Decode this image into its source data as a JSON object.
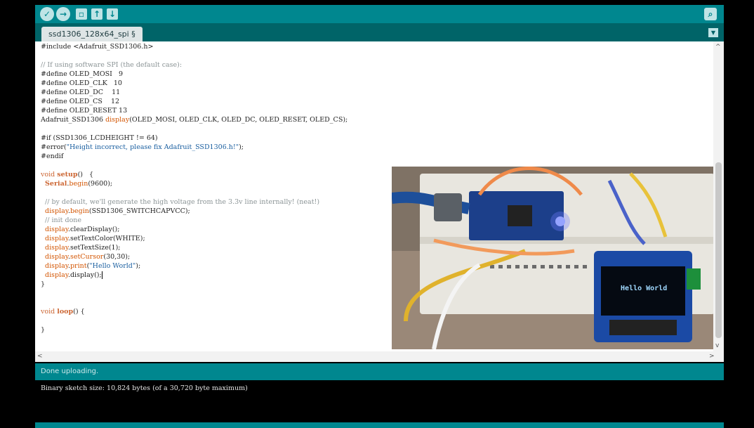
{
  "tab": {
    "label": "ssd1306_128x64_spi §"
  },
  "code": [
    [
      {
        "t": "#include <Adafruit_SSD1306.h>",
        "c": ""
      }
    ],
    [
      {
        "t": "",
        "c": ""
      }
    ],
    [
      {
        "t": "// If using software SPI (the default case):",
        "c": "cmt"
      }
    ],
    [
      {
        "t": "#define OLED_MOSI   9",
        "c": ""
      }
    ],
    [
      {
        "t": "#define OLED_CLK   10",
        "c": ""
      }
    ],
    [
      {
        "t": "#define OLED_DC    11",
        "c": ""
      }
    ],
    [
      {
        "t": "#define OLED_CS    12",
        "c": ""
      }
    ],
    [
      {
        "t": "#define OLED_RESET 13",
        "c": ""
      }
    ],
    [
      {
        "t": "Adafruit_SSD1306 ",
        "c": ""
      },
      {
        "t": "display",
        "c": "fn"
      },
      {
        "t": "(OLED_MOSI, OLED_CLK, OLED_DC, OLED_RESET, OLED_CS);",
        "c": ""
      }
    ],
    [
      {
        "t": "",
        "c": ""
      }
    ],
    [
      {
        "t": "#if (SSD1306_LCDHEIGHT != 64)",
        "c": ""
      }
    ],
    [
      {
        "t": "#error(",
        "c": ""
      },
      {
        "t": "\"Height incorrect, please fix Adafruit_SSD1306.h!\"",
        "c": "str"
      },
      {
        "t": ");",
        "c": ""
      }
    ],
    [
      {
        "t": "#endif",
        "c": ""
      }
    ],
    [
      {
        "t": "",
        "c": ""
      }
    ],
    [
      {
        "t": "void ",
        "c": "kw"
      },
      {
        "t": "setup",
        "c": "kwb"
      },
      {
        "t": "()   {",
        "c": ""
      }
    ],
    [
      {
        "t": "  ",
        "c": ""
      },
      {
        "t": "Serial",
        "c": "kwb"
      },
      {
        "t": ".",
        "c": ""
      },
      {
        "t": "begin",
        "c": "fn"
      },
      {
        "t": "(9600);",
        "c": ""
      }
    ],
    [
      {
        "t": "",
        "c": ""
      }
    ],
    [
      {
        "t": "  // by default, we'll generate the high voltage from the 3.3v line internally! (neat!)",
        "c": "cmt"
      }
    ],
    [
      {
        "t": "  ",
        "c": ""
      },
      {
        "t": "display",
        "c": "fn"
      },
      {
        "t": ".",
        "c": ""
      },
      {
        "t": "begin",
        "c": "fn"
      },
      {
        "t": "(SSD1306_SWITCHCAPVCC);",
        "c": ""
      }
    ],
    [
      {
        "t": "  // init done",
        "c": "cmt"
      }
    ],
    [
      {
        "t": "  ",
        "c": ""
      },
      {
        "t": "display",
        "c": "fn"
      },
      {
        "t": ".clearDisplay();",
        "c": ""
      }
    ],
    [
      {
        "t": "  ",
        "c": ""
      },
      {
        "t": "display",
        "c": "fn"
      },
      {
        "t": ".setTextColor(WHITE);",
        "c": ""
      }
    ],
    [
      {
        "t": "  ",
        "c": ""
      },
      {
        "t": "display",
        "c": "fn"
      },
      {
        "t": ".setTextSize(1);",
        "c": ""
      }
    ],
    [
      {
        "t": "  ",
        "c": ""
      },
      {
        "t": "display",
        "c": "fn"
      },
      {
        "t": ".",
        "c": ""
      },
      {
        "t": "setCursor",
        "c": "fn"
      },
      {
        "t": "(30,30);",
        "c": ""
      }
    ],
    [
      {
        "t": "  ",
        "c": ""
      },
      {
        "t": "display",
        "c": "fn"
      },
      {
        "t": ".",
        "c": ""
      },
      {
        "t": "print",
        "c": "fn"
      },
      {
        "t": "(",
        "c": ""
      },
      {
        "t": "\"Hello World\"",
        "c": "str"
      },
      {
        "t": ");",
        "c": ""
      }
    ],
    [
      {
        "t": "  ",
        "c": ""
      },
      {
        "t": "display",
        "c": "fn"
      },
      {
        "t": ".display();",
        "c": ""
      },
      {
        "t": "|CARET|",
        "c": "caret"
      }
    ],
    [
      {
        "t": "}",
        "c": ""
      }
    ],
    [
      {
        "t": "",
        "c": ""
      }
    ],
    [
      {
        "t": "",
        "c": ""
      }
    ],
    [
      {
        "t": "void ",
        "c": "kw"
      },
      {
        "t": "loop",
        "c": "kwb"
      },
      {
        "t": "() {",
        "c": ""
      }
    ],
    [
      {
        "t": "",
        "c": ""
      }
    ],
    [
      {
        "t": "}",
        "c": ""
      }
    ]
  ],
  "photo": {
    "oled_text": "Hello World"
  },
  "status": {
    "message": "Done uploading."
  },
  "console": {
    "output": "Binary sketch size: 10,824 bytes (of a 30,720 byte maximum)"
  },
  "colors": {
    "teal": "#00878f",
    "dark_teal": "#006468"
  },
  "icons": [
    "verify-icon",
    "upload-icon",
    "new-icon",
    "open-icon",
    "save-icon",
    "serial-monitor-icon",
    "tab-menu-icon"
  ]
}
